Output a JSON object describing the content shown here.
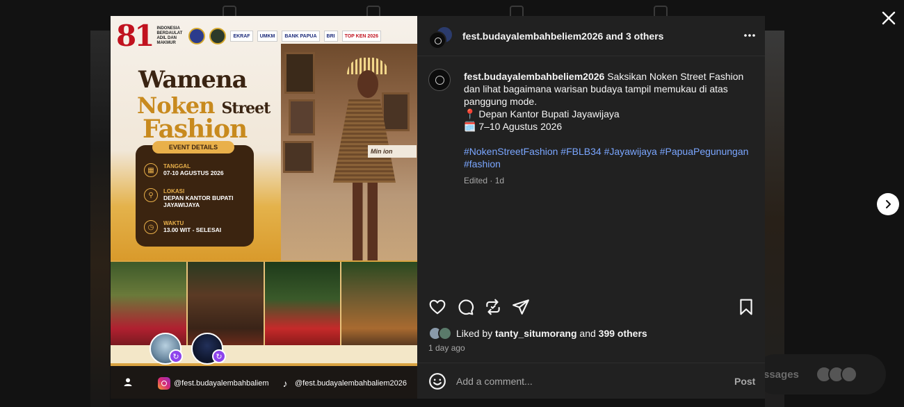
{
  "post": {
    "header": {
      "username": "fest.budayalembahbeliem2026",
      "others": " and 3 others",
      "more_icon": "more-horizontal-icon"
    },
    "caption": {
      "username": "fest.budayalembahbeliem2026",
      "text": "Saksikan Noken Street Fashion dan lihat bagaimana warisan budaya tampil memukau di atas panggung mode.",
      "location_emoji": "📍",
      "location": "Depan Kantor Bupati Jayawijaya",
      "date_emoji": "🗓️",
      "dates": "7–10 Agustus 2026",
      "hashtags": "#NokenStreetFashion #FBLB34 #Jayawijaya #PapuaPegunungan #fashion",
      "edited": "Edited · 1d"
    },
    "likes": {
      "prefix": "Liked by ",
      "user": "tanty_situmorang",
      "middle": " and ",
      "count": "399 others"
    },
    "time_ago": "1 day ago",
    "comment": {
      "placeholder": "Add a comment...",
      "post_label": "Post"
    }
  },
  "poster": {
    "logo_number": "81",
    "logo_text": "INDONESIA BERDAULAT ADIL DAN MAKMUR",
    "partners": [
      "EKRAF",
      "UMKM",
      "BANK PAPUA",
      "BRI",
      "TOP KEN 2026"
    ],
    "title_line1": "Wamena",
    "title_line2a": "Noken ",
    "title_line2b": "Street",
    "title_line3": "Fashion",
    "event_details_label": "EVENT DETAILS",
    "tanggal_label": "TANGGAL",
    "tanggal_value": "07-10 AGUSTUS 2026",
    "lokasi_label": "LOKASI",
    "lokasi_value1": "DEPAN KANTOR BUPATI",
    "lokasi_value2": "JAYAWIJAYA",
    "waktu_label": "WAKTU",
    "waktu_value": "13.00 WIT - SELESAI",
    "banner_text": "Min        ion",
    "instagram_handle": "@fest.budayalembahbaliem",
    "tiktok_handle": "@fest.budayalembahbaliem2026"
  },
  "background": {
    "messages_label": "ssages"
  },
  "colors": {
    "panel_bg": "#212121",
    "hashtag": "#7aa6ff",
    "poster_gold": "#c88a1e",
    "poster_brown": "#3b2410"
  }
}
